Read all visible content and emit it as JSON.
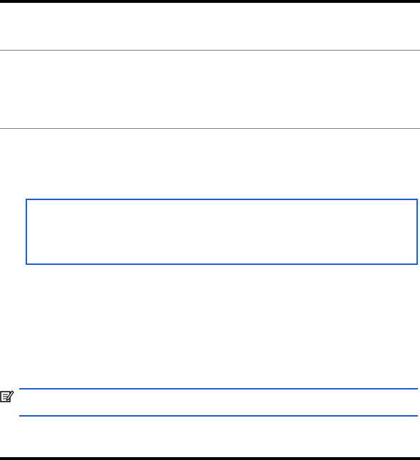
{
  "colors": {
    "rule_heavy": "#000000",
    "rule_light": "#808080",
    "accent": "#1f5fd6"
  },
  "icons": {
    "note": "note-icon"
  }
}
